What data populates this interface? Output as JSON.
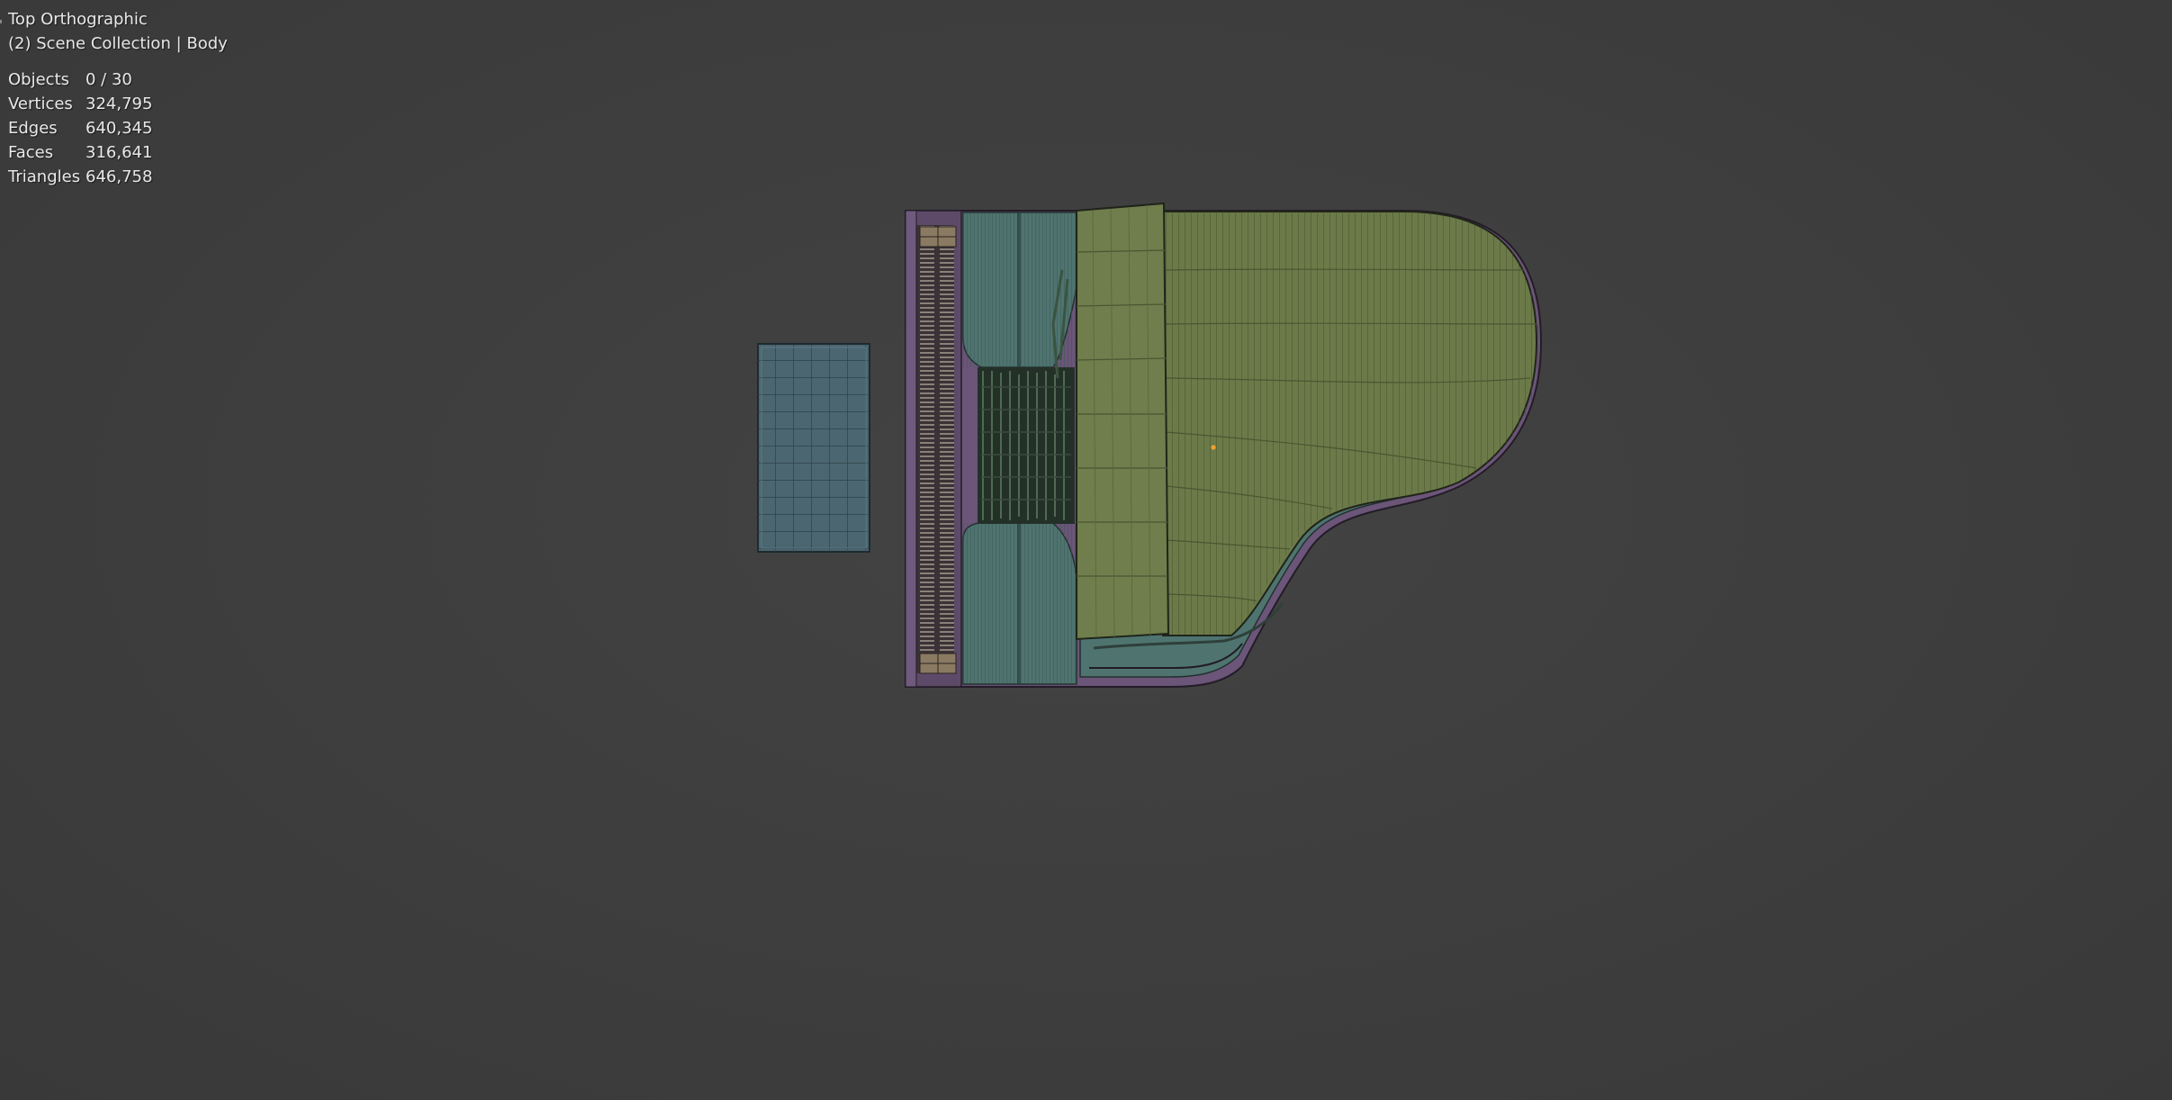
{
  "viewport": {
    "view_name": "Top Orthographic",
    "collection_line": "(2) Scene Collection | Body"
  },
  "stats": [
    {
      "label": "Objects",
      "value": "0 / 30"
    },
    {
      "label": "Vertices",
      "value": "324,795"
    },
    {
      "label": "Edges",
      "value": "640,345"
    },
    {
      "label": "Faces",
      "value": "316,641"
    },
    {
      "label": "Triangles",
      "value": "646,758"
    }
  ],
  "colors": {
    "background": "#3d3d3d",
    "lid_green": "#6b7a48",
    "body_teal": "#4f7470",
    "case_purple": "#6b5578",
    "keys_tan": "#8a7a62",
    "bench_blue": "#4b6670",
    "origin_orange": "#f0a030"
  }
}
